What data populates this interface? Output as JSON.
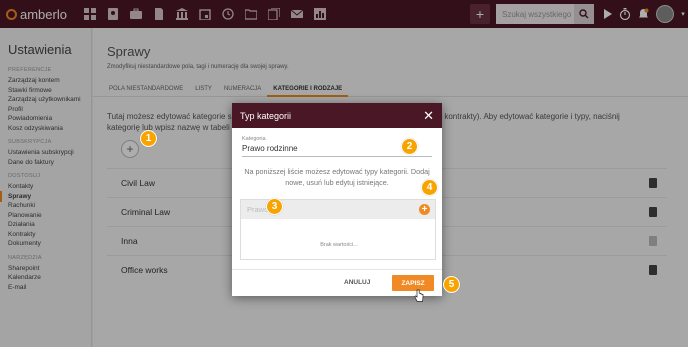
{
  "app": {
    "logo_text": "amberlo"
  },
  "topbar": {
    "nav_icons": [
      "dashboard-icon",
      "contacts-icon",
      "briefcase-icon",
      "document-icon",
      "bank-icon",
      "calendar-icon",
      "history-icon",
      "folder-icon",
      "files-icon",
      "mail-icon",
      "report-icon"
    ],
    "add_label": "+",
    "search_placeholder": "Szukaj wszystkiego"
  },
  "sidebar": {
    "title": "Ustawienia",
    "sections": [
      {
        "header": "PREFERENCJE",
        "items": [
          "Zarządzaj kontem",
          "Stawki firmowe",
          "Zarządzaj użytkownikami",
          "Profil",
          "Powiadomienia",
          "Kosz odzyskiwania"
        ]
      },
      {
        "header": "SUBSKRYPCJA",
        "items": [
          "Ustawienia subskrypcji",
          "Dane do faktury"
        ]
      },
      {
        "header": "DOSTOSUJ",
        "items": [
          "Kontakty",
          "Sprawy",
          "Rachunki",
          "Planowanie",
          "Działania",
          "Kontrakty",
          "Dokumenty"
        ]
      },
      {
        "header": "NARZĘDZIA",
        "items": [
          "Sharepoint",
          "Kalendarze",
          "E-mail"
        ]
      }
    ],
    "active_item": "Sprawy"
  },
  "main": {
    "title": "Sprawy",
    "subtitle": "Zmodyfikuj niestandardowe pola, tagi i numerację dla swojej sprawy.",
    "tabs": [
      "POLA NIESTANDARDOWE",
      "LISTY",
      "NUMERACJA",
      "KATEGORIE I RODZAJE"
    ],
    "active_tab": "KATEGORIE I RODZAJE",
    "intro_line1": "Tutaj możesz edytować kategorie sp",
    "intro_line1_tail": "ci, kontrakty). Aby edytować kategorie i typy, naciśnij",
    "intro_line2": "kategorię lub wpisz nazwę w tabeli",
    "add_label": "+",
    "categories": [
      "Civil Law",
      "Criminal Law",
      "Inna",
      "Office works"
    ]
  },
  "modal": {
    "title": "Typ kategorii",
    "close_label": "✕",
    "field_label": "Kategoria",
    "field_value": "Prawo rodzinne",
    "info_text": "Na poniższej liście możesz edytować typy kategorii. Dodaj nowe, usuń lub edytuj istniejące.",
    "input_placeholder": "Prawo",
    "add_label": "+",
    "empty_text": "Brak wartości...",
    "cancel_label": "ANULUJ",
    "save_label": "ZAPISZ"
  },
  "markers": [
    "1",
    "2",
    "3",
    "4",
    "5"
  ],
  "colors": {
    "brand": "#4a1726",
    "accent": "#f08a24",
    "marker": "#f7a400"
  }
}
